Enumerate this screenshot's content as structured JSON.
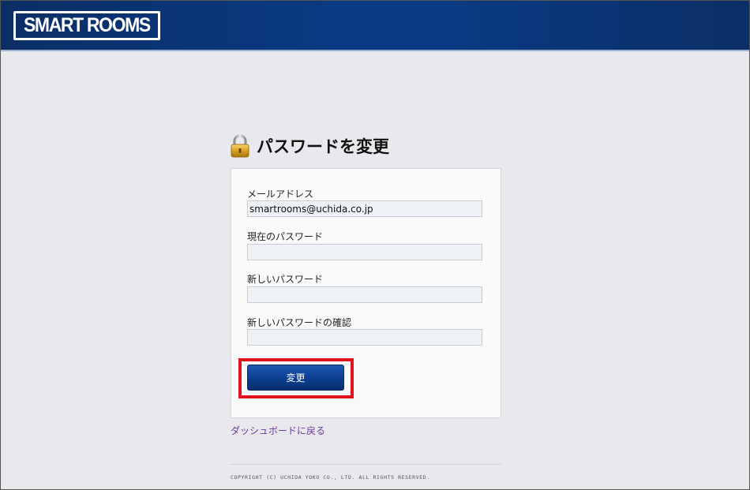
{
  "header": {
    "logo_text": "SMART ROOMS"
  },
  "page": {
    "title": "パスワードを変更"
  },
  "form": {
    "email_label": "メールアドレス",
    "email_value": "smartrooms@uchida.co.jp",
    "current_password_label": "現在のパスワード",
    "current_password_value": "",
    "new_password_label": "新しいパスワード",
    "new_password_value": "",
    "confirm_password_label": "新しいパスワードの確認",
    "confirm_password_value": "",
    "submit_label": "変更",
    "highlight_color": "#e0121b"
  },
  "links": {
    "back_to_dashboard": "ダッシュボードに戻る"
  },
  "footer": {
    "copyright": "COPYRIGHT (C) UCHIDA YOKO CO., LTD. ALL RIGHTS RESERVED."
  },
  "colors": {
    "header_blue": "#0a3a83",
    "button_blue": "#0b3e8e",
    "link_purple": "#6a3a9c",
    "background": "#e9e9ed"
  },
  "icons": {
    "heading_icon": "lock-icon"
  }
}
